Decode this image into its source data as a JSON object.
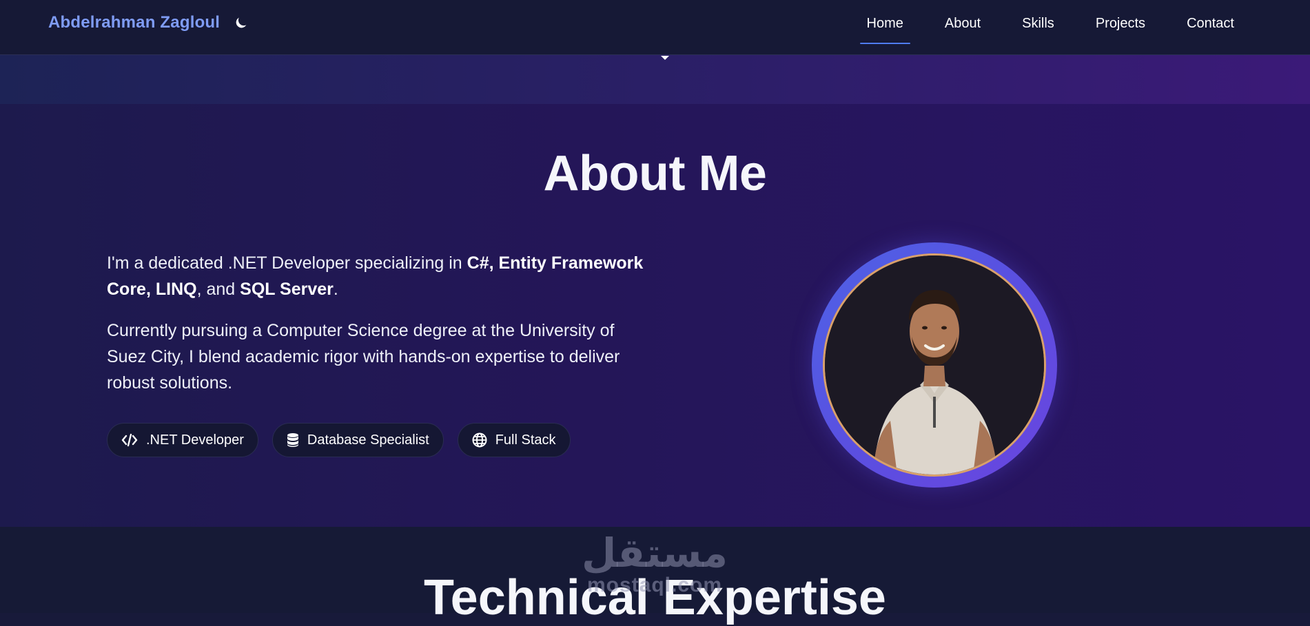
{
  "nav": {
    "brand": "Abdelrahman Zagloul",
    "theme_toggle_icon": "moon-icon",
    "items": [
      {
        "label": "Home",
        "active": true
      },
      {
        "label": "About",
        "active": false
      },
      {
        "label": "Skills",
        "active": false
      },
      {
        "label": "Projects",
        "active": false
      },
      {
        "label": "Contact",
        "active": false
      }
    ]
  },
  "about": {
    "title": "About Me",
    "paragraph1": {
      "part1": "I'm a dedicated .NET Developer specializing in ",
      "bold1": "C#, Entity Framework Core, LINQ",
      "part2": ", and ",
      "bold2": "SQL Server",
      "part3": "."
    },
    "paragraph2": "Currently pursuing a Computer Science degree at the University of Suez City, I blend academic rigor with hands-on expertise to deliver robust solutions.",
    "badges": [
      {
        "label": ".NET Developer",
        "icon": "code-icon"
      },
      {
        "label": "Database Specialist",
        "icon": "database-icon"
      },
      {
        "label": "Full Stack",
        "icon": "globe-icon"
      }
    ],
    "avatar_icon": "profile-photo"
  },
  "expertise": {
    "title": "Technical Expertise"
  },
  "watermark": {
    "arabic": "مستقل",
    "latin": "mostaql.com"
  },
  "colors": {
    "brand": "#7f9cf5",
    "nav_bg": "#161936",
    "active_underline": "#4f7cf0",
    "ring": "#5a4fe0",
    "photo_border": "#d9a06a"
  }
}
